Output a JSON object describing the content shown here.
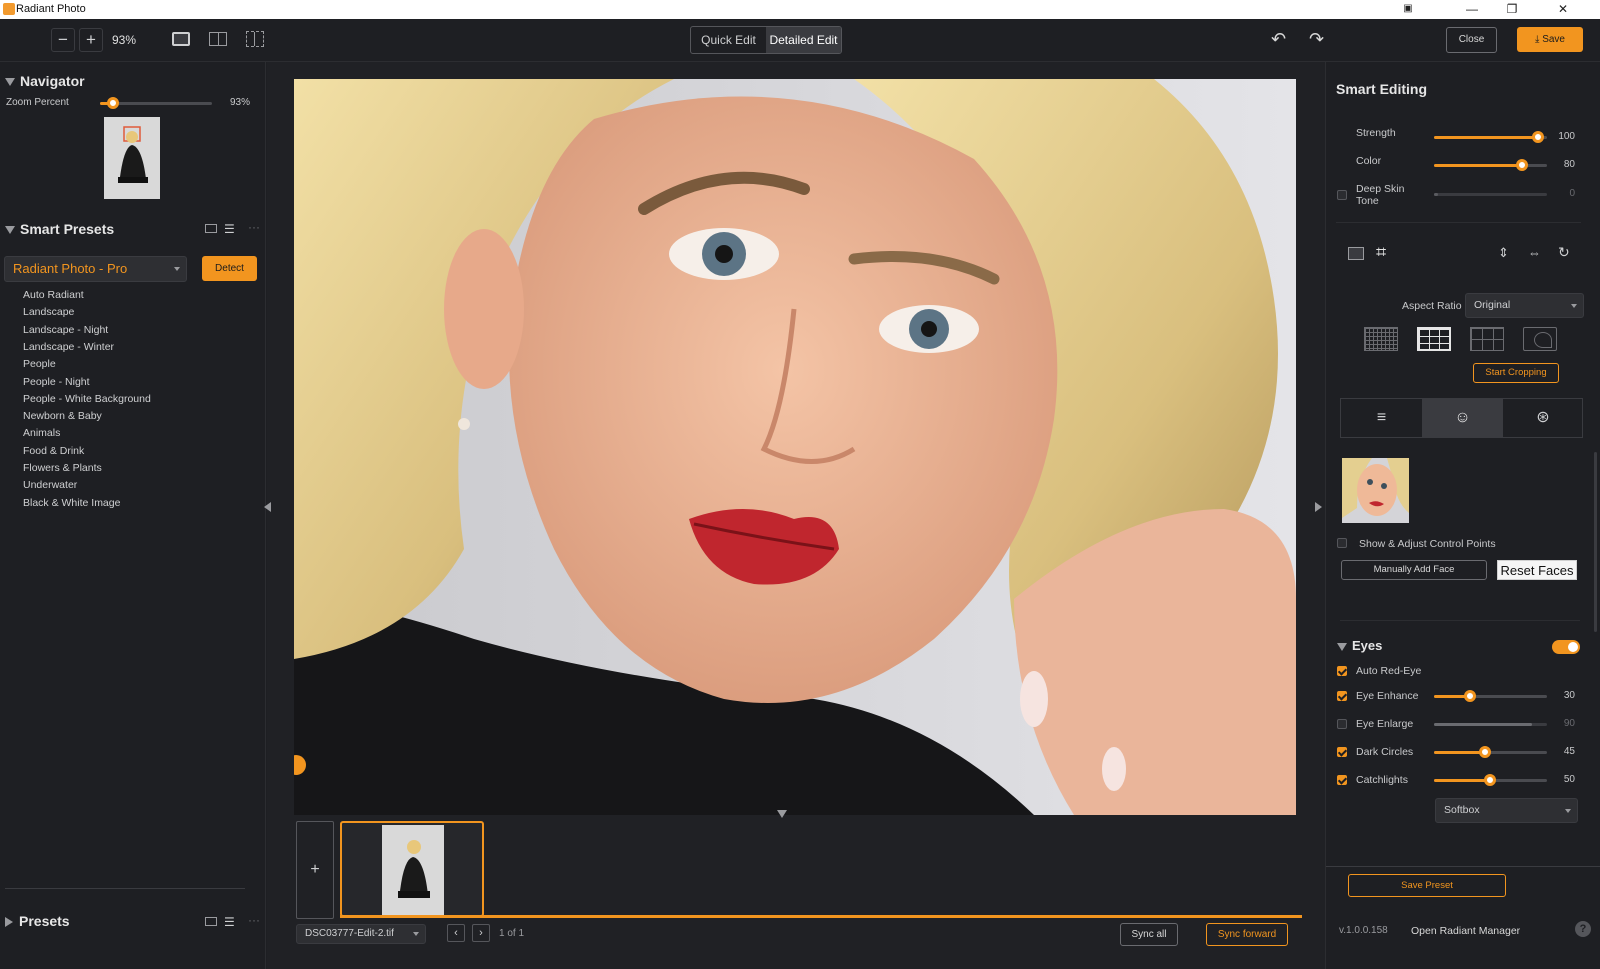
{
  "window": {
    "title": "Radiant Photo"
  },
  "toolbar": {
    "zoom_value": "93%",
    "mode_quick": "Quick Edit",
    "mode_detailed": "Detailed Edit",
    "close_label": "Close",
    "save_label": "Save"
  },
  "navigator": {
    "title": "Navigator",
    "zoom_label": "Zoom Percent",
    "zoom_value": "93%",
    "zoom_fraction": 0.12
  },
  "smart_presets": {
    "title": "Smart Presets",
    "selected": "Radiant Photo - Pro",
    "detect_label": "Detect",
    "items": [
      "Auto Radiant",
      "Landscape",
      "Landscape - Night",
      "Landscape - Winter",
      "People",
      "People - Night",
      "People - White Background",
      "Newborn & Baby",
      "Animals",
      "Food & Drink",
      "Flowers & Plants",
      "Underwater",
      "Black & White Image"
    ]
  },
  "presets": {
    "title": "Presets"
  },
  "filmstrip": {
    "add_label": "+",
    "file_name": "DSC03777-Edit-2.tif",
    "page_info": "1 of 1",
    "sync_all": "Sync all",
    "sync_forward": "Sync forward"
  },
  "smart_editing": {
    "title": "Smart Editing",
    "strength_label": "Strength",
    "strength_value": "100",
    "color_label": "Color",
    "color_value": "80",
    "deep_skin_label_1": "Deep Skin",
    "deep_skin_label_2": "Tone",
    "deep_skin_value": "0"
  },
  "crop": {
    "aspect_label": "Aspect Ratio",
    "aspect_value": "Original",
    "start_cropping": "Start Cropping"
  },
  "faces": {
    "show_control_points": "Show & Adjust Control Points",
    "manually_add": "Manually Add Face",
    "reset": "Reset Faces"
  },
  "eyes": {
    "title": "Eyes",
    "auto_red_eye": "Auto Red-Eye",
    "eye_enhance": "Eye Enhance",
    "eye_enhance_value": "30",
    "eye_enlarge": "Eye Enlarge",
    "eye_enlarge_value": "90",
    "dark_circles": "Dark Circles",
    "dark_circles_value": "45",
    "catchlights": "Catchlights",
    "catchlights_value": "50",
    "catchlight_style": "Softbox"
  },
  "footer": {
    "save_preset": "Save Preset",
    "version": "v.1.0.0.158",
    "open_manager": "Open Radiant Manager",
    "help": "?"
  },
  "colors": {
    "accent": "#f2951f",
    "panel": "#1e1f23"
  }
}
